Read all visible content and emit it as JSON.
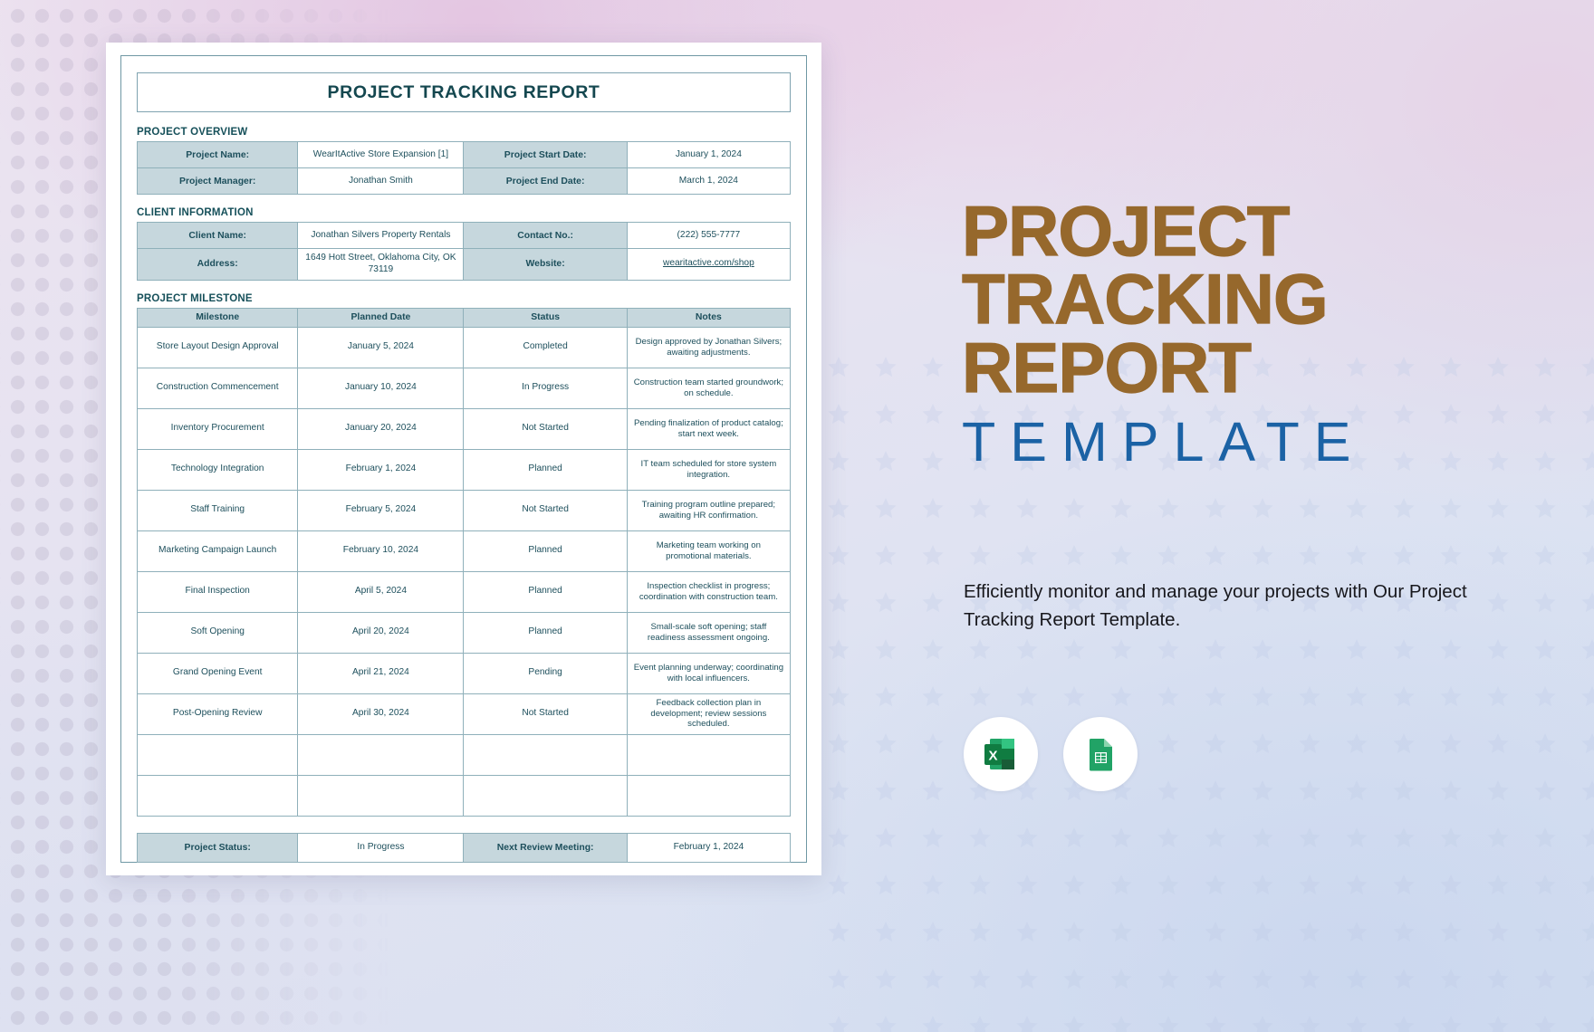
{
  "document": {
    "title": "PROJECT TRACKING REPORT",
    "sections": {
      "overview_heading": "PROJECT OVERVIEW",
      "client_heading": "CLIENT INFORMATION",
      "milestone_heading": "PROJECT MILESTONE"
    },
    "overview": {
      "rows": [
        {
          "label_a": "Project Name:",
          "value_a": "WearItActive Store Expansion [1]",
          "label_b": "Project Start Date:",
          "value_b": "January 1, 2024"
        },
        {
          "label_a": "Project Manager:",
          "value_a": "Jonathan Smith",
          "label_b": "Project End Date:",
          "value_b": "March 1, 2024"
        }
      ]
    },
    "client": {
      "rows": [
        {
          "label_a": "Client Name:",
          "value_a": "Jonathan Silvers Property Rentals",
          "label_b": "Contact No.:",
          "value_b": "(222) 555-7777"
        },
        {
          "label_a": "Address:",
          "value_a": "1649 Hott Street, Oklahoma City, OK 73119",
          "label_b": "Website:",
          "value_b": "wearitactive.com/shop"
        }
      ]
    },
    "milestone": {
      "headers": [
        "Milestone",
        "Planned Date",
        "Status",
        "Notes"
      ],
      "rows": [
        {
          "milestone": "Store Layout Design Approval",
          "date": "January 5, 2024",
          "status": "Completed",
          "notes": "Design approved by Jonathan Silvers; awaiting adjustments."
        },
        {
          "milestone": "Construction Commencement",
          "date": "January 10, 2024",
          "status": "In Progress",
          "notes": "Construction team started groundwork; on schedule."
        },
        {
          "milestone": "Inventory Procurement",
          "date": "January 20, 2024",
          "status": "Not Started",
          "notes": "Pending finalization of product catalog; start next week."
        },
        {
          "milestone": "Technology Integration",
          "date": "February 1, 2024",
          "status": "Planned",
          "notes": "IT team scheduled for store system integration."
        },
        {
          "milestone": "Staff Training",
          "date": "February 5, 2024",
          "status": "Not Started",
          "notes": "Training program outline prepared; awaiting HR confirmation."
        },
        {
          "milestone": "Marketing Campaign Launch",
          "date": "February 10, 2024",
          "status": "Planned",
          "notes": "Marketing team working on promotional materials."
        },
        {
          "milestone": "Final Inspection",
          "date": "April 5, 2024",
          "status": "Planned",
          "notes": "Inspection checklist in progress; coordination with construction team."
        },
        {
          "milestone": "Soft Opening",
          "date": "April 20, 2024",
          "status": "Planned",
          "notes": "Small-scale soft opening; staff readiness assessment ongoing."
        },
        {
          "milestone": "Grand Opening Event",
          "date": "April 21, 2024",
          "status": "Pending",
          "notes": "Event planning underway; coordinating with local influencers."
        },
        {
          "milestone": "Post-Opening Review",
          "date": "April 30, 2024",
          "status": "Not Started",
          "notes": "Feedback collection plan in development; review sessions scheduled."
        },
        {
          "milestone": "",
          "date": "",
          "status": "",
          "notes": ""
        },
        {
          "milestone": "",
          "date": "",
          "status": "",
          "notes": ""
        }
      ]
    },
    "footer": {
      "status_label": "Project Status:",
      "status_value": "In Progress",
      "review_label": "Next Review Meeting:",
      "review_value": "February 1, 2024"
    }
  },
  "promo": {
    "line1": "PROJECT",
    "line2": "TRACKING",
    "line3": "REPORT",
    "line4": "TEMPLATE",
    "description": "Efficiently monitor and manage your projects with Our Project Tracking Report Template.",
    "formats": [
      {
        "name": "excel-icon",
        "label": "X"
      },
      {
        "name": "google-sheets-icon",
        "label": ""
      }
    ]
  },
  "colors": {
    "heading_teal": "#14474F",
    "table_header_fill": "#C6D7DD",
    "table_border": "#8FB0BA",
    "promo_brown": "#96682C",
    "promo_blue": "#1B62A5",
    "excel_green": "#1E7145",
    "sheets_green": "#21A366"
  }
}
